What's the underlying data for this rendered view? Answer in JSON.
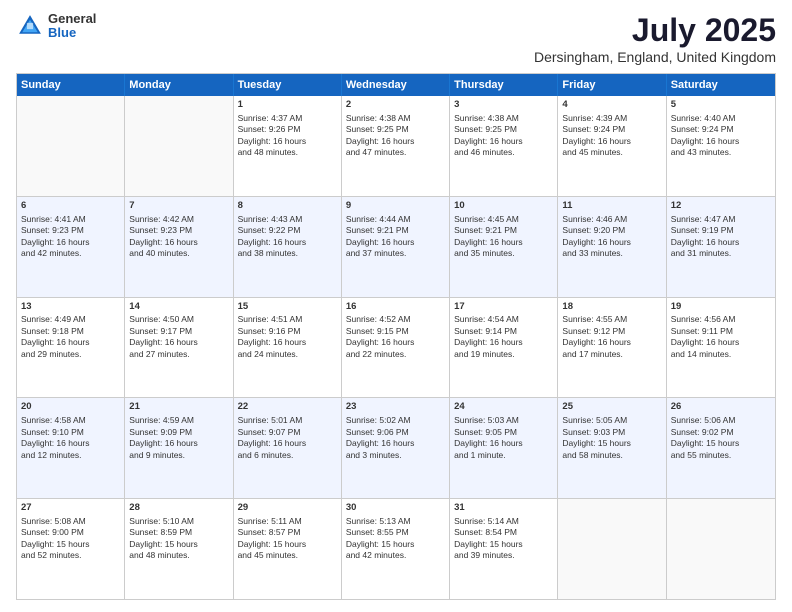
{
  "header": {
    "logo": {
      "line1": "General",
      "line2": "Blue"
    },
    "title": "July 2025",
    "subtitle": "Dersingham, England, United Kingdom"
  },
  "days": [
    "Sunday",
    "Monday",
    "Tuesday",
    "Wednesday",
    "Thursday",
    "Friday",
    "Saturday"
  ],
  "rows": [
    [
      {
        "day": "",
        "empty": true
      },
      {
        "day": "",
        "empty": true
      },
      {
        "day": "1",
        "line1": "Sunrise: 4:37 AM",
        "line2": "Sunset: 9:26 PM",
        "line3": "Daylight: 16 hours",
        "line4": "and 48 minutes."
      },
      {
        "day": "2",
        "line1": "Sunrise: 4:38 AM",
        "line2": "Sunset: 9:25 PM",
        "line3": "Daylight: 16 hours",
        "line4": "and 47 minutes."
      },
      {
        "day": "3",
        "line1": "Sunrise: 4:38 AM",
        "line2": "Sunset: 9:25 PM",
        "line3": "Daylight: 16 hours",
        "line4": "and 46 minutes."
      },
      {
        "day": "4",
        "line1": "Sunrise: 4:39 AM",
        "line2": "Sunset: 9:24 PM",
        "line3": "Daylight: 16 hours",
        "line4": "and 45 minutes."
      },
      {
        "day": "5",
        "line1": "Sunrise: 4:40 AM",
        "line2": "Sunset: 9:24 PM",
        "line3": "Daylight: 16 hours",
        "line4": "and 43 minutes."
      }
    ],
    [
      {
        "day": "6",
        "line1": "Sunrise: 4:41 AM",
        "line2": "Sunset: 9:23 PM",
        "line3": "Daylight: 16 hours",
        "line4": "and 42 minutes."
      },
      {
        "day": "7",
        "line1": "Sunrise: 4:42 AM",
        "line2": "Sunset: 9:23 PM",
        "line3": "Daylight: 16 hours",
        "line4": "and 40 minutes."
      },
      {
        "day": "8",
        "line1": "Sunrise: 4:43 AM",
        "line2": "Sunset: 9:22 PM",
        "line3": "Daylight: 16 hours",
        "line4": "and 38 minutes."
      },
      {
        "day": "9",
        "line1": "Sunrise: 4:44 AM",
        "line2": "Sunset: 9:21 PM",
        "line3": "Daylight: 16 hours",
        "line4": "and 37 minutes."
      },
      {
        "day": "10",
        "line1": "Sunrise: 4:45 AM",
        "line2": "Sunset: 9:21 PM",
        "line3": "Daylight: 16 hours",
        "line4": "and 35 minutes."
      },
      {
        "day": "11",
        "line1": "Sunrise: 4:46 AM",
        "line2": "Sunset: 9:20 PM",
        "line3": "Daylight: 16 hours",
        "line4": "and 33 minutes."
      },
      {
        "day": "12",
        "line1": "Sunrise: 4:47 AM",
        "line2": "Sunset: 9:19 PM",
        "line3": "Daylight: 16 hours",
        "line4": "and 31 minutes."
      }
    ],
    [
      {
        "day": "13",
        "line1": "Sunrise: 4:49 AM",
        "line2": "Sunset: 9:18 PM",
        "line3": "Daylight: 16 hours",
        "line4": "and 29 minutes."
      },
      {
        "day": "14",
        "line1": "Sunrise: 4:50 AM",
        "line2": "Sunset: 9:17 PM",
        "line3": "Daylight: 16 hours",
        "line4": "and 27 minutes."
      },
      {
        "day": "15",
        "line1": "Sunrise: 4:51 AM",
        "line2": "Sunset: 9:16 PM",
        "line3": "Daylight: 16 hours",
        "line4": "and 24 minutes."
      },
      {
        "day": "16",
        "line1": "Sunrise: 4:52 AM",
        "line2": "Sunset: 9:15 PM",
        "line3": "Daylight: 16 hours",
        "line4": "and 22 minutes."
      },
      {
        "day": "17",
        "line1": "Sunrise: 4:54 AM",
        "line2": "Sunset: 9:14 PM",
        "line3": "Daylight: 16 hours",
        "line4": "and 19 minutes."
      },
      {
        "day": "18",
        "line1": "Sunrise: 4:55 AM",
        "line2": "Sunset: 9:12 PM",
        "line3": "Daylight: 16 hours",
        "line4": "and 17 minutes."
      },
      {
        "day": "19",
        "line1": "Sunrise: 4:56 AM",
        "line2": "Sunset: 9:11 PM",
        "line3": "Daylight: 16 hours",
        "line4": "and 14 minutes."
      }
    ],
    [
      {
        "day": "20",
        "line1": "Sunrise: 4:58 AM",
        "line2": "Sunset: 9:10 PM",
        "line3": "Daylight: 16 hours",
        "line4": "and 12 minutes."
      },
      {
        "day": "21",
        "line1": "Sunrise: 4:59 AM",
        "line2": "Sunset: 9:09 PM",
        "line3": "Daylight: 16 hours",
        "line4": "and 9 minutes."
      },
      {
        "day": "22",
        "line1": "Sunrise: 5:01 AM",
        "line2": "Sunset: 9:07 PM",
        "line3": "Daylight: 16 hours",
        "line4": "and 6 minutes."
      },
      {
        "day": "23",
        "line1": "Sunrise: 5:02 AM",
        "line2": "Sunset: 9:06 PM",
        "line3": "Daylight: 16 hours",
        "line4": "and 3 minutes."
      },
      {
        "day": "24",
        "line1": "Sunrise: 5:03 AM",
        "line2": "Sunset: 9:05 PM",
        "line3": "Daylight: 16 hours",
        "line4": "and 1 minute."
      },
      {
        "day": "25",
        "line1": "Sunrise: 5:05 AM",
        "line2": "Sunset: 9:03 PM",
        "line3": "Daylight: 15 hours",
        "line4": "and 58 minutes."
      },
      {
        "day": "26",
        "line1": "Sunrise: 5:06 AM",
        "line2": "Sunset: 9:02 PM",
        "line3": "Daylight: 15 hours",
        "line4": "and 55 minutes."
      }
    ],
    [
      {
        "day": "27",
        "line1": "Sunrise: 5:08 AM",
        "line2": "Sunset: 9:00 PM",
        "line3": "Daylight: 15 hours",
        "line4": "and 52 minutes."
      },
      {
        "day": "28",
        "line1": "Sunrise: 5:10 AM",
        "line2": "Sunset: 8:59 PM",
        "line3": "Daylight: 15 hours",
        "line4": "and 48 minutes."
      },
      {
        "day": "29",
        "line1": "Sunrise: 5:11 AM",
        "line2": "Sunset: 8:57 PM",
        "line3": "Daylight: 15 hours",
        "line4": "and 45 minutes."
      },
      {
        "day": "30",
        "line1": "Sunrise: 5:13 AM",
        "line2": "Sunset: 8:55 PM",
        "line3": "Daylight: 15 hours",
        "line4": "and 42 minutes."
      },
      {
        "day": "31",
        "line1": "Sunrise: 5:14 AM",
        "line2": "Sunset: 8:54 PM",
        "line3": "Daylight: 15 hours",
        "line4": "and 39 minutes."
      },
      {
        "day": "",
        "empty": true
      },
      {
        "day": "",
        "empty": true
      }
    ]
  ],
  "rowShades": [
    false,
    true,
    false,
    true,
    false
  ]
}
